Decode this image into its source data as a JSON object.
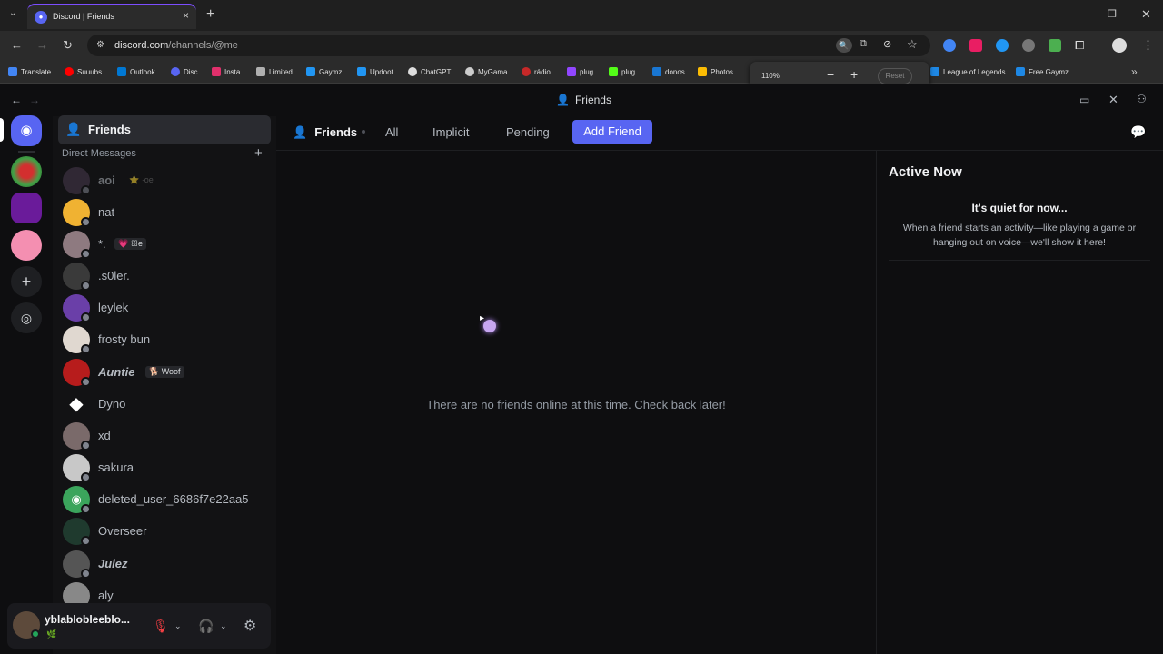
{
  "browser": {
    "tab_title": "Discord | Friends",
    "url_host": "discord.com",
    "url_path": "/channels/@me",
    "bookmarks": [
      "Translate",
      "Suuubs",
      "Outlook",
      "Disc",
      "Insta",
      "Limited",
      "Gaymz",
      "Updoot",
      "ChatGPT",
      "MyGama",
      "rádio",
      "plug",
      "plug",
      "donos",
      "Photos",
      "League of Legends",
      "Free Gaymz"
    ],
    "zoom": {
      "percent": "110%",
      "reset": "Reset"
    },
    "overflow": "»"
  },
  "discord": {
    "title": "Friends",
    "sidebar": {
      "friends_label": "Friends",
      "dm_header": "Direct Messages",
      "dms": [
        {
          "name": "aoi",
          "tag": "⭐ ·oe"
        },
        {
          "name": "nat",
          "tag": ""
        },
        {
          "name": "*.",
          "tag": "💗 ꕥe"
        },
        {
          "name": ".s0ler.",
          "tag": ""
        },
        {
          "name": "leylek",
          "tag": ""
        },
        {
          "name": "frosty bun",
          "tag": ""
        },
        {
          "name": "Auntie",
          "tag": "🐕 Woof"
        },
        {
          "name": "Dyno",
          "tag": ""
        },
        {
          "name": "xd",
          "tag": ""
        },
        {
          "name": "sakura",
          "tag": ""
        },
        {
          "name": "deleted_user_6686f7e22aa5",
          "tag": ""
        },
        {
          "name": "Overseer",
          "tag": ""
        },
        {
          "name": "Julez",
          "tag": ""
        },
        {
          "name": "aly",
          "tag": ""
        }
      ]
    },
    "user": {
      "name": "yblabloblееblo...",
      "sub": "🌿"
    },
    "header": {
      "friends": "Friends",
      "tabs": [
        "All",
        "Implicit",
        "Pending"
      ],
      "add_friend": "Add Friend"
    },
    "empty_message": "There are no friends online at this time. Check back later!",
    "active_now": {
      "title": "Active Now",
      "quiet": "It's quiet for now...",
      "desc": "When a friend starts an activity—like playing a game or hanging out on voice—we'll show it here!"
    }
  }
}
